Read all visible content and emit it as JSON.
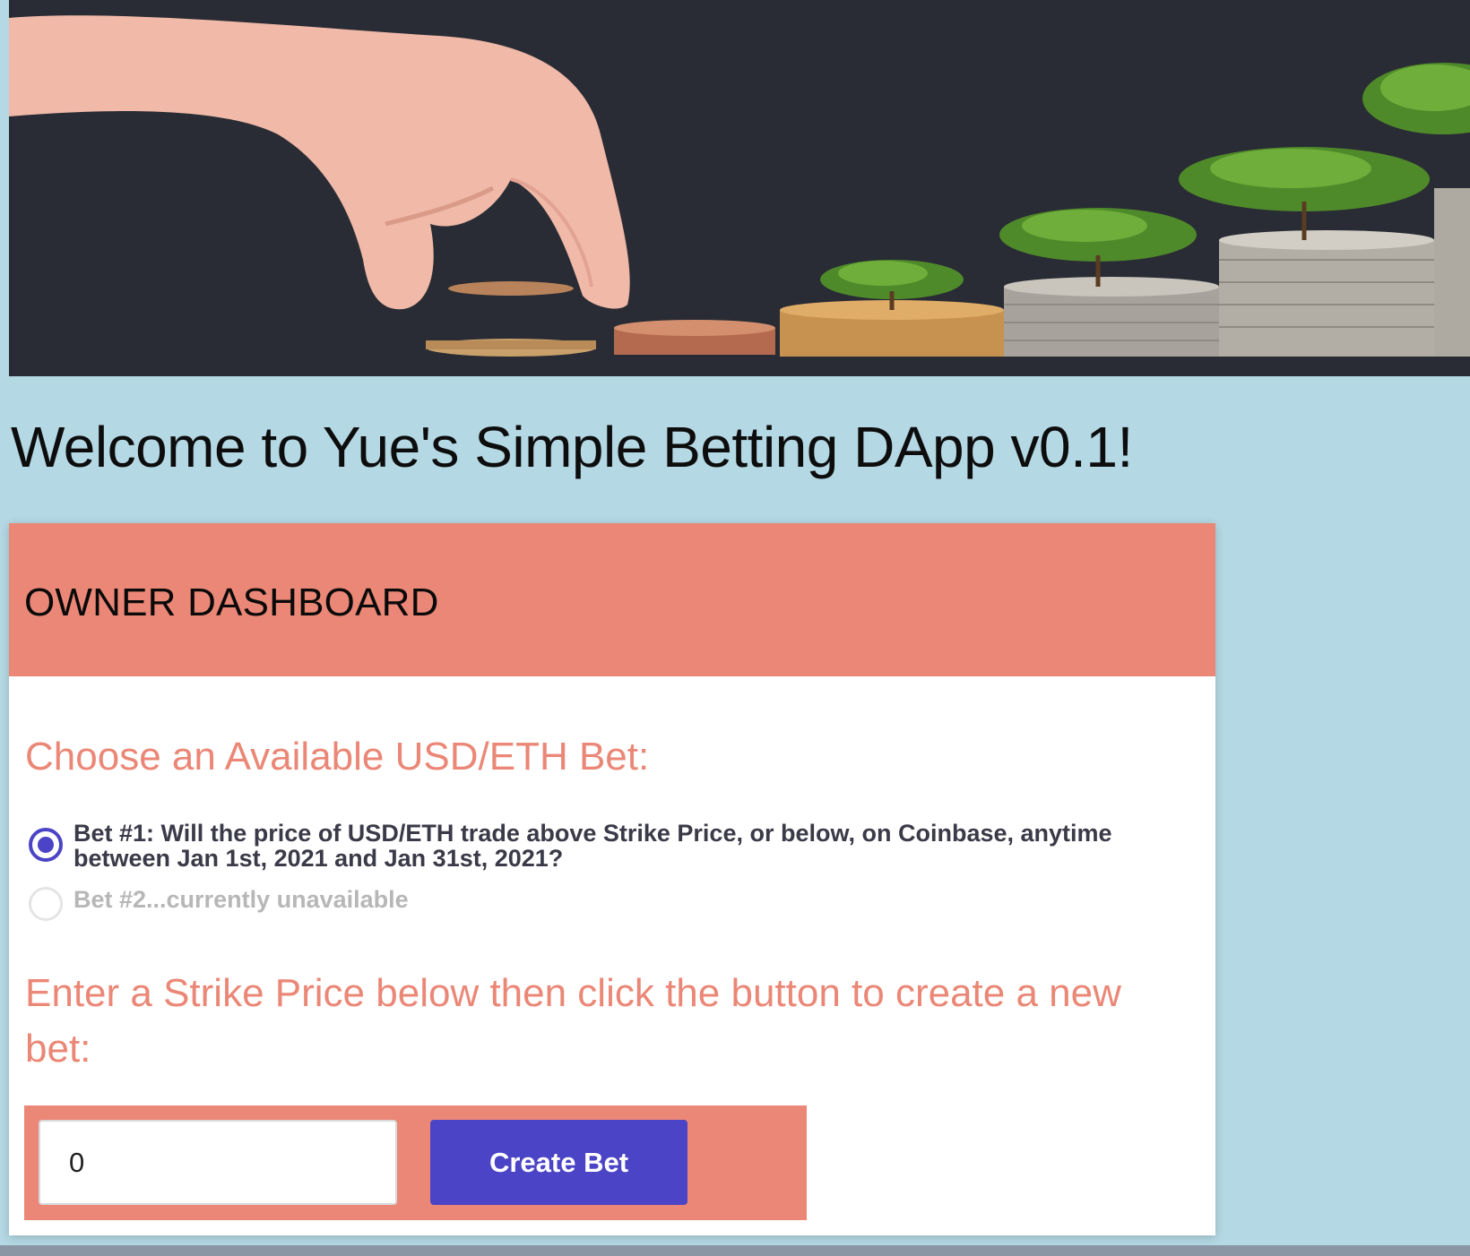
{
  "hero": {
    "image_name": "hand-placing-coin-on-growing-coin-stacks-with-trees"
  },
  "page_title": "Welcome to Yue's Simple Betting DApp v0.1!",
  "dashboard": {
    "header": "OWNER DASHBOARD",
    "choose_heading": "Choose an Available USD/ETH Bet:",
    "bets": [
      {
        "label": "Bet #1: Will the price of USD/ETH trade above Strike Price, or below, on Coinbase, anytime between Jan 1st, 2021 and Jan 31st, 2021?",
        "selected": true,
        "disabled": false
      },
      {
        "label": "Bet #2...currently unavailable",
        "selected": false,
        "disabled": true
      }
    ],
    "enter_heading": "Enter a Strike Price below then click the button to create a new bet:",
    "strike_input": {
      "value": "0"
    },
    "create_button_label": "Create Bet"
  },
  "colors": {
    "page_background": "#b4d8e4",
    "accent_salmon": "#eb8776",
    "button_purple": "#4b44c6",
    "hero_background": "#292c34"
  }
}
